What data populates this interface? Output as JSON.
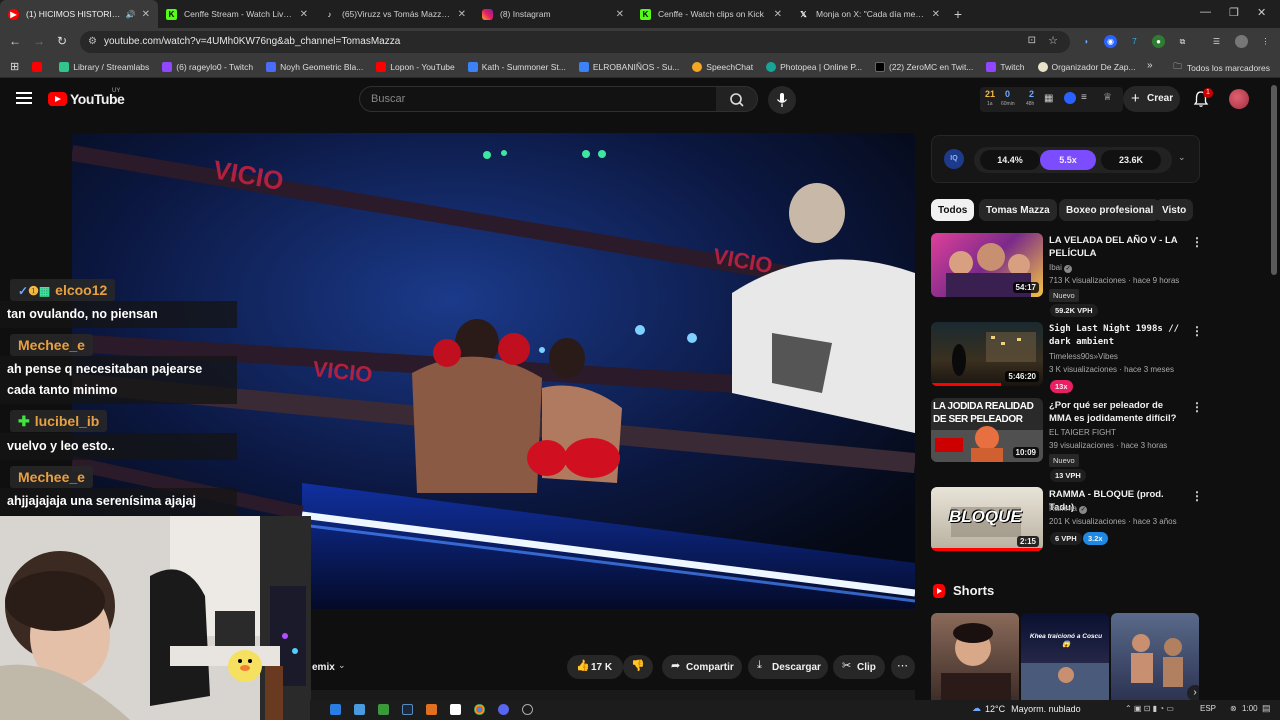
{
  "browser": {
    "tabs": [
      {
        "title": "(1) HICIMOS HISTORIA - Yo",
        "favicon": "youtube-icon",
        "active": true,
        "audio": true
      },
      {
        "title": "Cenffe Stream - Watch Live on",
        "favicon": "kick-icon"
      },
      {
        "title": "(65)Viruzz vs Tomás Mazza ¡Ro",
        "favicon": "tiktok-icon"
      },
      {
        "title": "(8) Instagram",
        "favicon": "instagram-icon"
      },
      {
        "title": "Cenffe - Watch clips on Kick",
        "favicon": "kick-icon"
      },
      {
        "title": "Monja on X: \"Cada día me pert",
        "favicon": "x-icon"
      }
    ],
    "url": "youtube.com/watch?v=4UMh0KW76ng&ab_channel=TomasMazza",
    "bookmarks": [
      {
        "label": "",
        "color": "#ff0000"
      },
      {
        "label": "Library / Streamlabs",
        "color": "#31c48d"
      },
      {
        "label": "(6) rageylo0 - Twitch",
        "color": "#9146ff"
      },
      {
        "label": "Noyh Geometric Bla...",
        "color": "#4a6cf7"
      },
      {
        "label": "Lopon - YouTube",
        "color": "#ff0000"
      },
      {
        "label": "Kath - Summoner St...",
        "color": "#3b82f6"
      },
      {
        "label": "ELROBANIÑOS - Su...",
        "color": "#3b82f6"
      },
      {
        "label": "SpeechChat",
        "color": "#f5a623"
      },
      {
        "label": "Photopea | Online P...",
        "color": "#18a497"
      },
      {
        "label": "(22) ZeroMC en Twit...",
        "color": "#000000"
      },
      {
        "label": "Twitch",
        "color": "#9146ff"
      },
      {
        "label": "Organizador De Zap...",
        "color": "#e9e3c9"
      }
    ],
    "all_bookmarks": "Todos los marcadores"
  },
  "youtube": {
    "logo": "YouTube",
    "country": "UY",
    "search_placeholder": "Buscar",
    "stats": {
      "n1": "21",
      "l1": "1a",
      "n2": "0",
      "l2": "60min",
      "n3": "2",
      "l3": "48h"
    },
    "create_label": "Crear",
    "notif_count": "1"
  },
  "video_actions": {
    "remix": "emix",
    "likes": "17 K",
    "share": "Compartir",
    "download": "Descargar",
    "clip": "Clip"
  },
  "iq_widget": {
    "pct": "14.4%",
    "mult": "5.5x",
    "views": "23.6K"
  },
  "chips": [
    "Todos",
    "Tomas Mazza",
    "Boxeo profesional",
    "Visto"
  ],
  "recommendations": [
    {
      "title": "LA VELADA DEL AÑO V - LA PELÍCULA",
      "channel": "Ibai",
      "meta": "713 K visualizaciones · hace 9 horas",
      "badge": "Nuevo",
      "vph": "59.2K VPH",
      "duration": "54:17"
    },
    {
      "title": "Sigh Last Night 1998s // dark ambient",
      "channel": "Timeless90s»Vibes",
      "meta": "3 K visualizaciones · hace 3 meses",
      "badge": "",
      "vph": "13x",
      "duration": "5:46:20"
    },
    {
      "title": "¿Por qué ser peleador de MMA es jodidamente difícil?",
      "channel": "EL TAIGER FIGHT",
      "meta": "39 visualizaciones · hace 3 horas",
      "badge": "Nuevo",
      "vph": "13 VPH",
      "duration": "10:09",
      "thumb_text": "LA JODIDA REALIDAD DE SER PELEADOR"
    },
    {
      "title": "RAMMA - BLOQUE (prod. Tadu)",
      "channel": "Ramma",
      "meta": "201 K visualizaciones · hace 3 años",
      "badge": "",
      "vph": "6 VPH",
      "vph2": "3.2x",
      "duration": "2:15",
      "thumb_text": "BLOQUE"
    }
  ],
  "shorts": {
    "header": "Shorts",
    "items": [
      {
        "caption": ""
      },
      {
        "caption": "Khea traicionó a Coscu 😱"
      },
      {
        "caption": ""
      }
    ]
  },
  "chat": [
    {
      "user": "elcoo12",
      "text": "tan ovulando, no piensan"
    },
    {
      "user": "Mechee_e",
      "text": "ah pense q necesitaban pajearse cada tanto minimo"
    },
    {
      "user": "lucibel_ib",
      "text": "vuelvo y leo esto.."
    },
    {
      "user": "Mechee_e",
      "text": "ahjjajajaja una serenísima ajajaj"
    }
  ],
  "taskbar": {
    "temp": "12°C",
    "weather": "Mayorm. nublado",
    "lang": "ESP",
    "time": "1:00"
  },
  "colors": {
    "yt_red": "#ff0000",
    "iq_purple": "#7c4dff",
    "chat_name": "#e8a040"
  }
}
